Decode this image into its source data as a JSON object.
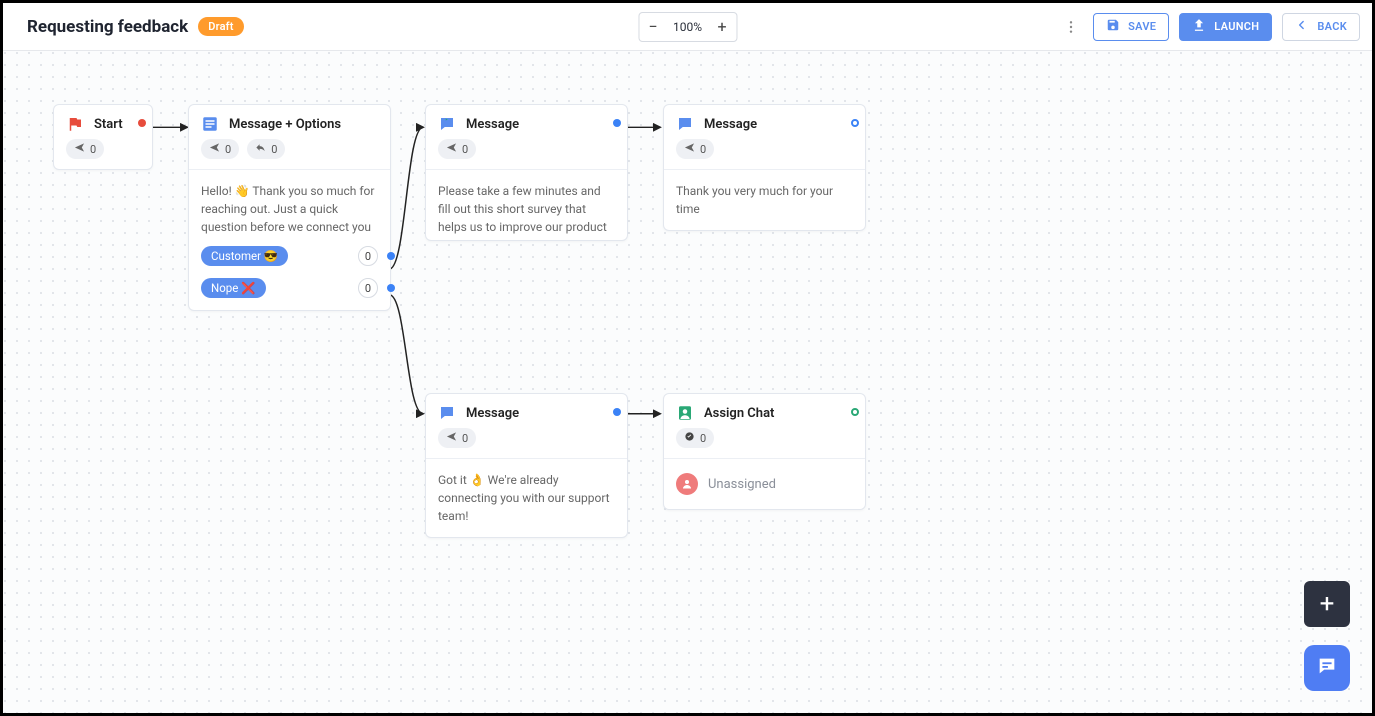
{
  "header": {
    "title": "Requesting feedback",
    "status_badge": "Draft",
    "zoom": {
      "value": "100%"
    },
    "buttons": {
      "save": "SAVE",
      "launch": "LAUNCH",
      "back": "BACK"
    }
  },
  "canvas": {
    "nodes": {
      "start": {
        "title": "Start",
        "stats": {
          "sent": 0
        }
      },
      "msg_options": {
        "title": "Message + Options",
        "stats": {
          "sent": 0,
          "reply": 0
        },
        "body": "Hello! 👋 Thank you so much for reaching out. Just a quick question before we connect you with a support agent. Are you our customer",
        "options": [
          {
            "label": "Customer 😎",
            "count": 0
          },
          {
            "label": "Nope ❌",
            "count": 0
          }
        ]
      },
      "msg_survey": {
        "title": "Message",
        "stats": {
          "sent": 0
        },
        "body": "Please take a few minutes and fill out this short survey that helps us to improve our product and customer service"
      },
      "msg_thanks": {
        "title": "Message",
        "stats": {
          "sent": 0
        },
        "body": "Thank you very much for your time"
      },
      "msg_gotit": {
        "title": "Message",
        "stats": {
          "sent": 0
        },
        "body": "Got it 👌 We're already connecting you with our support team!"
      },
      "assign": {
        "title": "Assign Chat",
        "stats": {
          "assigned": 0
        },
        "assignee": "Unassigned"
      }
    }
  }
}
